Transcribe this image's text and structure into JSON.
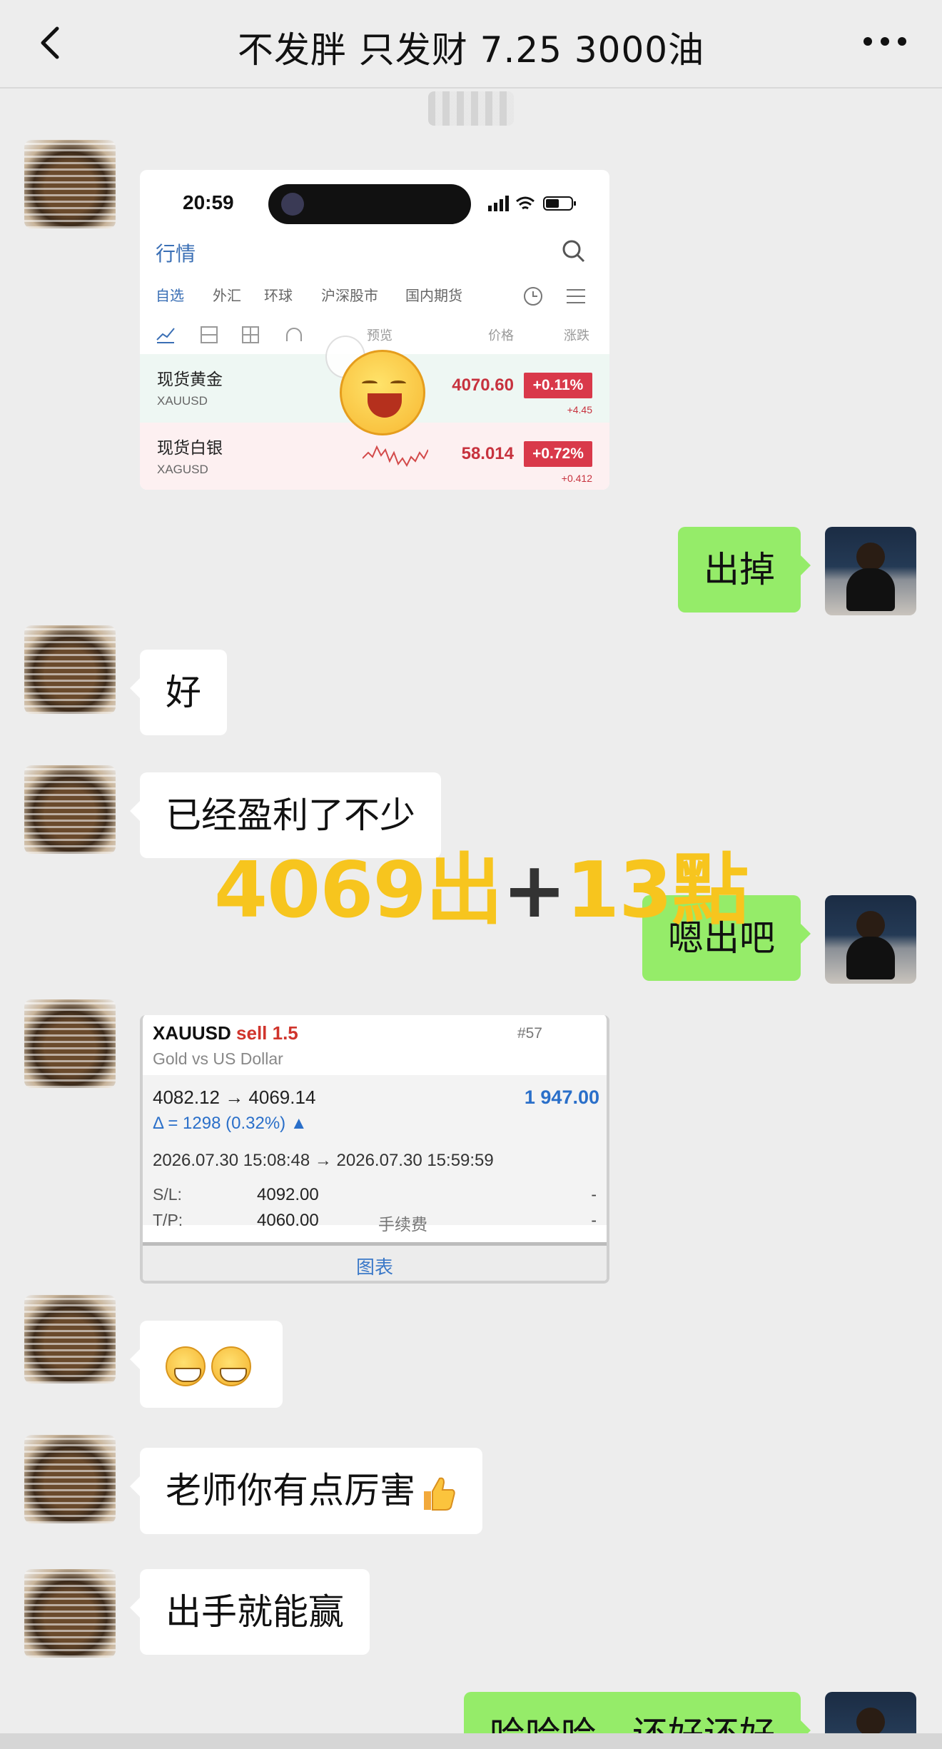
{
  "header": {
    "title": "不发胖 只发财 7.25 3000油",
    "back_icon": "chevron-left-icon",
    "more_icon": "more-dots-icon"
  },
  "phone_screenshot": {
    "time": "20:59",
    "section_title": "行情",
    "tabs": [
      "自选",
      "外汇",
      "环球",
      "沪深股市",
      "国内期货"
    ],
    "subheaders": [
      "预览",
      "价格",
      "涨跌"
    ],
    "rows": [
      {
        "name": "现货黄金",
        "code": "XAUUSD",
        "price": "4070.60",
        "change": "+0.11%",
        "delta": "+4.45"
      },
      {
        "name": "现货白银",
        "code": "XAGUSD",
        "price": "58.014",
        "change": "+0.72%",
        "delta": "+0.412"
      }
    ]
  },
  "messages": {
    "m1": "出掉",
    "m2": "好",
    "m3": "已经盈利了不少",
    "m4": "嗯出吧",
    "m5": "老师你有点厉害",
    "m6": "出手就能赢",
    "m7": "哈哈哈，还好还好"
  },
  "overlay": {
    "part1": "4069出",
    "plus": "+",
    "part2": "13點"
  },
  "trade_screenshot": {
    "symbol": "XAUUSD",
    "side": "sell 1.5",
    "description": "Gold vs US Dollar",
    "ticket": "#57",
    "price_range": "4082.12 → 4069.14",
    "profit": "1 947.00",
    "delta": "Δ = 1298 (0.32%)",
    "time_range": "2026.07.30 15:08:48 → 2026.07.30 15:59:59",
    "sl_label": "S/L:",
    "sl_value": "4092.00",
    "tp_label": "T/P:",
    "tp_value": "4060.00",
    "fee_label": "手续费",
    "dash1": "-",
    "dash2": "-",
    "chart_link": "图表"
  },
  "colors": {
    "incoming_bubble": "#ffffff",
    "outgoing_bubble": "#95ec69",
    "overlay_text": "#f7c51e",
    "price_red": "#d9394a",
    "profit_blue": "#2a6fc9"
  }
}
